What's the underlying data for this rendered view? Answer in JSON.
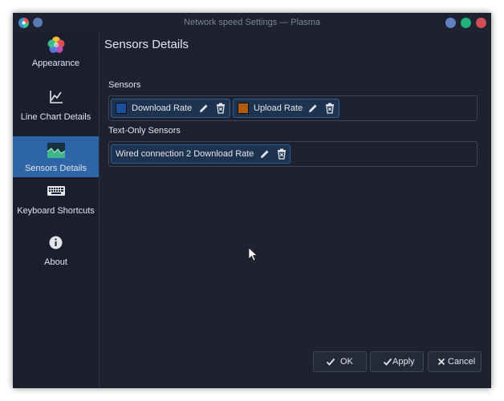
{
  "window": {
    "title": "Network speed Settings — Plasma"
  },
  "sidebar": {
    "items": [
      {
        "label": "Appearance",
        "icon": "appearance-icon"
      },
      {
        "label": "Line Chart Details",
        "icon": "line-chart-icon"
      },
      {
        "label": "Sensors Details",
        "icon": "sensors-details-icon",
        "active": true
      },
      {
        "label": "Keyboard Shortcuts",
        "icon": "keyboard-icon"
      },
      {
        "label": "About",
        "icon": "info-icon"
      }
    ]
  },
  "main": {
    "title": "Sensors Details",
    "sensors_label": "Sensors",
    "sensors": [
      {
        "label": "Download Rate",
        "color": "#1a4f9c"
      },
      {
        "label": "Upload Rate",
        "color": "#b35a10"
      }
    ],
    "text_only_label": "Text-Only Sensors",
    "text_only_sensors": [
      {
        "label": "Wired connection 2 Download Rate"
      }
    ]
  },
  "buttons": {
    "ok": "OK",
    "apply": "Apply",
    "cancel": "Cancel"
  },
  "colors": {
    "window_bg": "#1d2130",
    "accent": "#2e64a8",
    "chip_bg": "#1e3350"
  }
}
